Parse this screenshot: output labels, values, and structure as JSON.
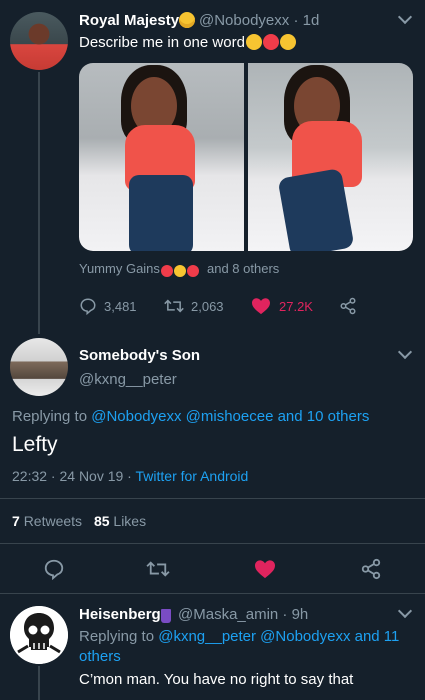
{
  "tweet1": {
    "name": "Royal Majesty",
    "handle": "@Nobodyexx · 1d",
    "text": "Describe me in one word",
    "likers_prefix": "Yummy Gains",
    "likers_suffix": "and 8 others",
    "replies": "3,481",
    "retweets": "2,063",
    "likes": "27.2K"
  },
  "tweet2": {
    "name": "Somebody's Son",
    "handle": "@kxng__peter",
    "replying_label": "Replying to",
    "replying_users": "@Nobodyexx @mishoecee and 10 others",
    "text": "Lefty",
    "timestamp": "22:32 · 24 Nov 19 ·",
    "source": "Twitter for Android",
    "retweets_count": "7",
    "retweets_label": "Retweets",
    "likes_count": "85",
    "likes_label": "Likes"
  },
  "tweet3": {
    "name": "Heisenberg",
    "handle": "@Maska_amin · 9h",
    "replying_label": "Replying to",
    "replying_users_line1": "@kxng__peter @Nobodyexx and 11",
    "replying_users_line2": "others",
    "text": "C’mon man. You have no right to say that"
  },
  "colors": {
    "background": "#15202b",
    "link": "#1da1f2",
    "muted": "#8899a6",
    "like": "#e0245e"
  },
  "icons": [
    "reply-icon",
    "retweet-icon",
    "heart-icon",
    "share-icon",
    "chevron-down-icon",
    "verified-emoji-icon"
  ]
}
